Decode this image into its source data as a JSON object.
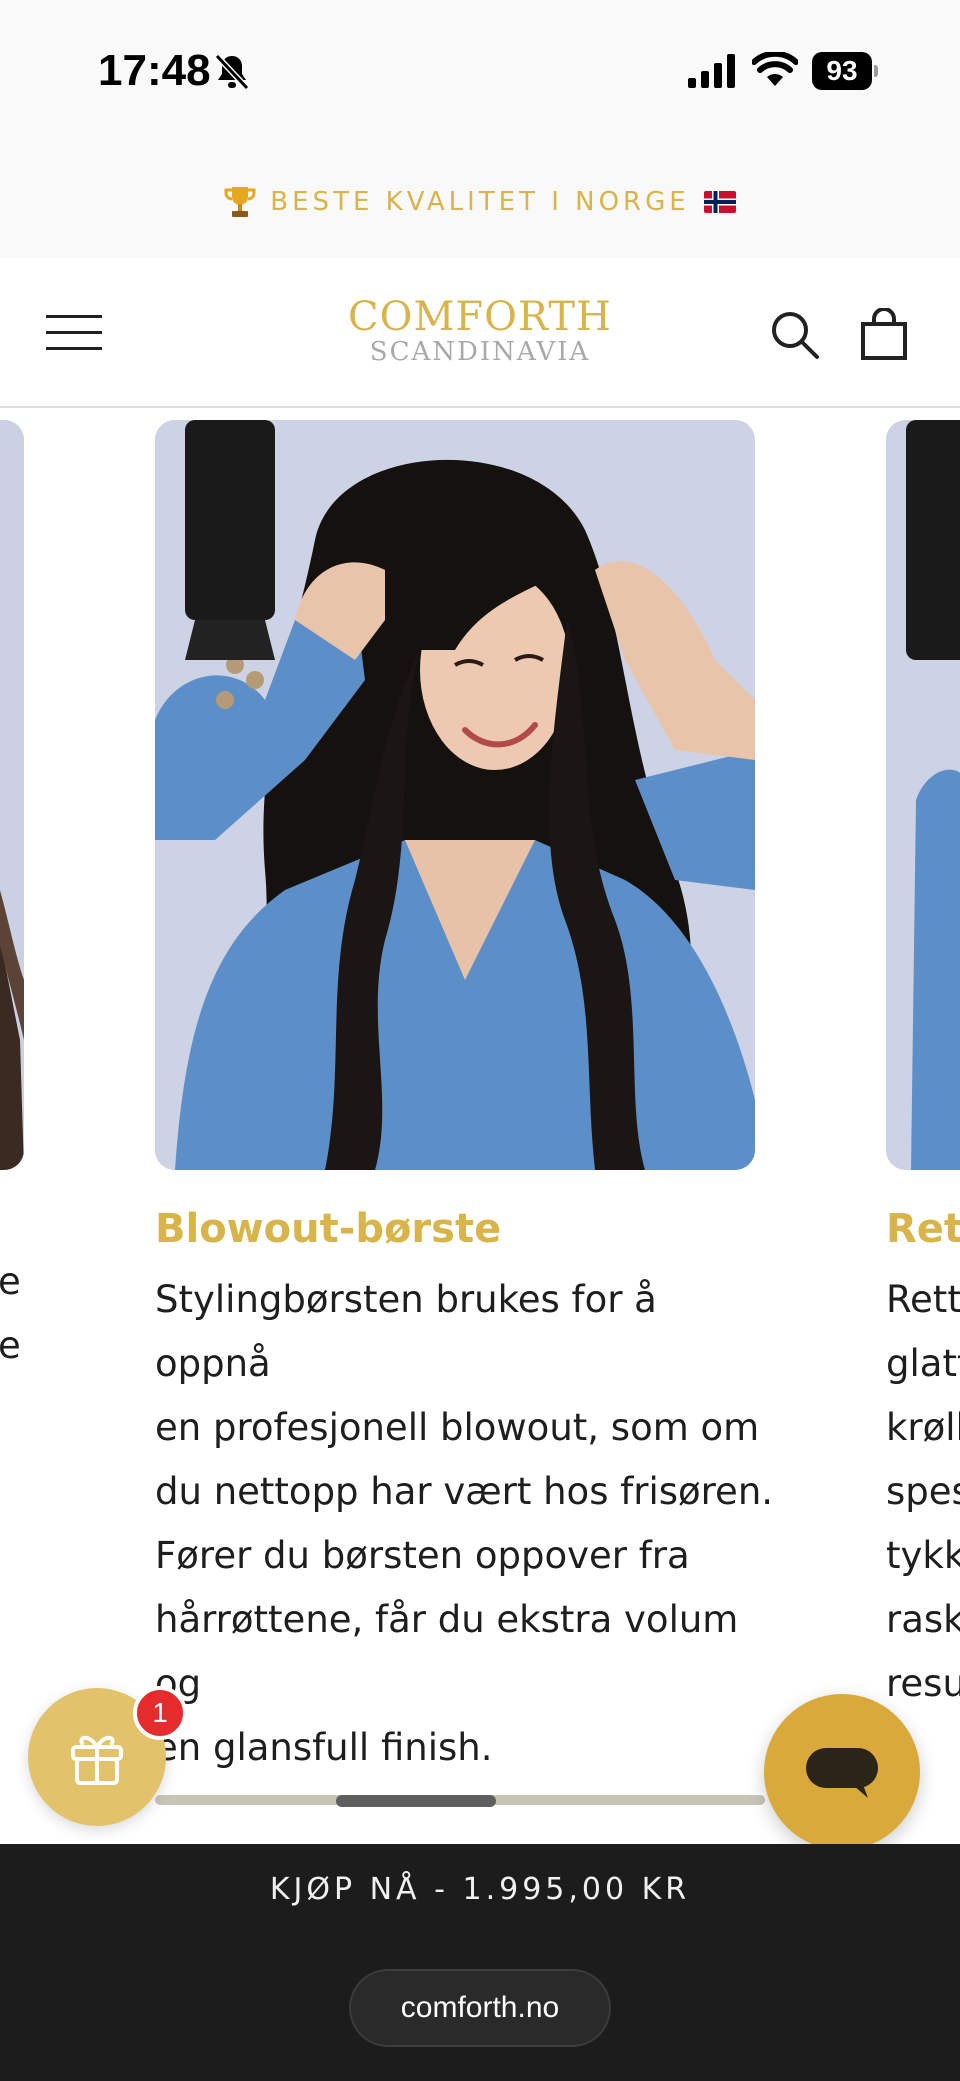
{
  "status_bar": {
    "time": "17:48",
    "battery": "93",
    "icons": [
      "bell-slash-icon",
      "signal-icon",
      "wifi-icon",
      "battery-icon"
    ]
  },
  "announcement": {
    "text": "BESTE KVALITET I NORGE",
    "icons": [
      "trophy-icon",
      "norway-flag-icon"
    ]
  },
  "header": {
    "logo_main": "COMFORTH",
    "logo_sub": "SCANDINAVIA",
    "icons": [
      "menu-icon",
      "search-icon",
      "bag-icon"
    ]
  },
  "carousel": {
    "left_card": {
      "partial_lines": [
        "e",
        "e"
      ]
    },
    "main_card": {
      "title": "Blowout-børste",
      "description_lines": [
        "Stylingbørsten brukes for å oppnå",
        "en profesjonell blowout, som om",
        "du nettopp har vært hos frisøren.",
        "Fører du børsten oppover fra",
        "hårrøttene, får du ekstra volum og",
        "en glansfull finish."
      ]
    },
    "right_card": {
      "title": "Rett",
      "partial_lines": [
        "Rett",
        "glatt",
        "krøll",
        "spes",
        "tykk",
        "rask",
        "resu"
      ]
    },
    "scroll_position": 0.4
  },
  "floating": {
    "gift_badge": "1",
    "icons": [
      "gift-icon",
      "chat-icon"
    ]
  },
  "buy_bar": {
    "button_label": "KJØP NÅ - 1.995,00 KR",
    "url": "comforth.no"
  },
  "colors": {
    "gold": "#d8b44a",
    "chat_gold": "#d9a93c",
    "dark": "#1c1c1c",
    "badge_red": "#e52b2b"
  }
}
